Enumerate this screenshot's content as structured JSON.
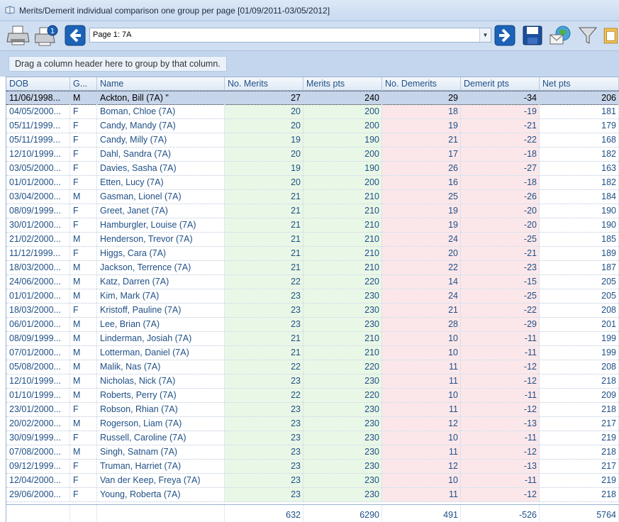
{
  "window": {
    "title": "Merits/Demerit individual comparison one group per page [01/09/2011-03/05/2012]"
  },
  "toolbar": {
    "page_value": "Page 1: 7A"
  },
  "grouping_hint": "Drag a column header here to group by that column.",
  "columns": [
    "DOB",
    "G...",
    "Name",
    "No. Merits",
    "Merits pts",
    "No. Demerits",
    "Demerit pts",
    "Net pts"
  ],
  "rows": [
    {
      "dob": "11/06/1998...",
      "g": "M",
      "name": "Ackton, Bill (7A)   \"",
      "merits": "27",
      "merits_pts": "240",
      "demerits": "29",
      "demerit_pts": "-34",
      "net": "206"
    },
    {
      "dob": "04/05/2000...",
      "g": "F",
      "name": "Boman, Chloe (7A)",
      "merits": "20",
      "merits_pts": "200",
      "demerits": "18",
      "demerit_pts": "-19",
      "net": "181"
    },
    {
      "dob": "05/11/1999...",
      "g": "F",
      "name": "Candy, Mandy (7A)",
      "merits": "20",
      "merits_pts": "200",
      "demerits": "19",
      "demerit_pts": "-21",
      "net": "179"
    },
    {
      "dob": "05/11/1999...",
      "g": "F",
      "name": "Candy, Milly (7A)",
      "merits": "19",
      "merits_pts": "190",
      "demerits": "21",
      "demerit_pts": "-22",
      "net": "168"
    },
    {
      "dob": "12/10/1999...",
      "g": "F",
      "name": "Dahl, Sandra (7A)",
      "merits": "20",
      "merits_pts": "200",
      "demerits": "17",
      "demerit_pts": "-18",
      "net": "182"
    },
    {
      "dob": "03/05/2000...",
      "g": "F",
      "name": "Davies, Sasha (7A)",
      "merits": "19",
      "merits_pts": "190",
      "demerits": "26",
      "demerit_pts": "-27",
      "net": "163"
    },
    {
      "dob": "01/01/2000...",
      "g": "F",
      "name": "Etten, Lucy (7A)",
      "merits": "20",
      "merits_pts": "200",
      "demerits": "16",
      "demerit_pts": "-18",
      "net": "182"
    },
    {
      "dob": "03/04/2000...",
      "g": "M",
      "name": "Gasman, Lionel (7A)",
      "merits": "21",
      "merits_pts": "210",
      "demerits": "25",
      "demerit_pts": "-26",
      "net": "184"
    },
    {
      "dob": "08/09/1999...",
      "g": "F",
      "name": "Greet, Janet (7A)",
      "merits": "21",
      "merits_pts": "210",
      "demerits": "19",
      "demerit_pts": "-20",
      "net": "190"
    },
    {
      "dob": "30/01/2000...",
      "g": "F",
      "name": "Hamburgler, Louise (7A)",
      "merits": "21",
      "merits_pts": "210",
      "demerits": "19",
      "demerit_pts": "-20",
      "net": "190"
    },
    {
      "dob": "21/02/2000...",
      "g": "M",
      "name": "Henderson, Trevor (7A)",
      "merits": "21",
      "merits_pts": "210",
      "demerits": "24",
      "demerit_pts": "-25",
      "net": "185"
    },
    {
      "dob": "11/12/1999...",
      "g": "F",
      "name": "Higgs, Cara (7A)",
      "merits": "21",
      "merits_pts": "210",
      "demerits": "20",
      "demerit_pts": "-21",
      "net": "189"
    },
    {
      "dob": "18/03/2000...",
      "g": "M",
      "name": "Jackson, Terrence (7A)",
      "merits": "21",
      "merits_pts": "210",
      "demerits": "22",
      "demerit_pts": "-23",
      "net": "187"
    },
    {
      "dob": "24/06/2000...",
      "g": "M",
      "name": "Katz, Darren (7A)",
      "merits": "22",
      "merits_pts": "220",
      "demerits": "14",
      "demerit_pts": "-15",
      "net": "205"
    },
    {
      "dob": "01/01/2000...",
      "g": "M",
      "name": "Kim, Mark (7A)",
      "merits": "23",
      "merits_pts": "230",
      "demerits": "24",
      "demerit_pts": "-25",
      "net": "205"
    },
    {
      "dob": "18/03/2000...",
      "g": "F",
      "name": "Kristoff, Pauline (7A)",
      "merits": "23",
      "merits_pts": "230",
      "demerits": "21",
      "demerit_pts": "-22",
      "net": "208"
    },
    {
      "dob": "06/01/2000...",
      "g": "M",
      "name": "Lee, Brian (7A)",
      "merits": "23",
      "merits_pts": "230",
      "demerits": "28",
      "demerit_pts": "-29",
      "net": "201"
    },
    {
      "dob": "08/09/1999...",
      "g": "M",
      "name": "Linderman, Josiah (7A)",
      "merits": "21",
      "merits_pts": "210",
      "demerits": "10",
      "demerit_pts": "-11",
      "net": "199"
    },
    {
      "dob": "07/01/2000...",
      "g": "M",
      "name": "Lotterman, Daniel (7A)",
      "merits": "21",
      "merits_pts": "210",
      "demerits": "10",
      "demerit_pts": "-11",
      "net": "199"
    },
    {
      "dob": "05/08/2000...",
      "g": "M",
      "name": "Malik, Nas (7A)",
      "merits": "22",
      "merits_pts": "220",
      "demerits": "11",
      "demerit_pts": "-12",
      "net": "208"
    },
    {
      "dob": "12/10/1999...",
      "g": "M",
      "name": "Nicholas, Nick (7A)",
      "merits": "23",
      "merits_pts": "230",
      "demerits": "11",
      "demerit_pts": "-12",
      "net": "218"
    },
    {
      "dob": "01/10/1999...",
      "g": "M",
      "name": "Roberts, Perry (7A)",
      "merits": "22",
      "merits_pts": "220",
      "demerits": "10",
      "demerit_pts": "-11",
      "net": "209"
    },
    {
      "dob": "23/01/2000...",
      "g": "F",
      "name": "Robson, Rhian (7A)",
      "merits": "23",
      "merits_pts": "230",
      "demerits": "11",
      "demerit_pts": "-12",
      "net": "218"
    },
    {
      "dob": "20/02/2000...",
      "g": "M",
      "name": "Rogerson, Liam (7A)",
      "merits": "23",
      "merits_pts": "230",
      "demerits": "12",
      "demerit_pts": "-13",
      "net": "217"
    },
    {
      "dob": "30/09/1999...",
      "g": "F",
      "name": "Russell, Caroline (7A)",
      "merits": "23",
      "merits_pts": "230",
      "demerits": "10",
      "demerit_pts": "-11",
      "net": "219"
    },
    {
      "dob": "07/08/2000...",
      "g": "M",
      "name": "Singh, Satnam (7A)",
      "merits": "23",
      "merits_pts": "230",
      "demerits": "11",
      "demerit_pts": "-12",
      "net": "218"
    },
    {
      "dob": "09/12/1999...",
      "g": "F",
      "name": "Truman, Harriet (7A)",
      "merits": "23",
      "merits_pts": "230",
      "demerits": "12",
      "demerit_pts": "-13",
      "net": "217"
    },
    {
      "dob": "12/04/2000...",
      "g": "F",
      "name": "Van der Keep, Freya (7A)",
      "merits": "23",
      "merits_pts": "230",
      "demerits": "10",
      "demerit_pts": "-11",
      "net": "219"
    },
    {
      "dob": "29/06/2000...",
      "g": "F",
      "name": "Young, Roberta (7A)",
      "merits": "23",
      "merits_pts": "230",
      "demerits": "11",
      "demerit_pts": "-12",
      "net": "218"
    }
  ],
  "totals": {
    "dob": "",
    "g": "",
    "name": "",
    "merits": "632",
    "merits_pts": "6290",
    "demerits": "491",
    "demerit_pts": "-526",
    "net": "5764"
  },
  "selected_row": 0,
  "colors": {
    "merit_bg": "#e9f7e6",
    "demerit_bg": "#fbe7ea",
    "text": "#1f4f86",
    "selection": "#c7d5ea"
  }
}
